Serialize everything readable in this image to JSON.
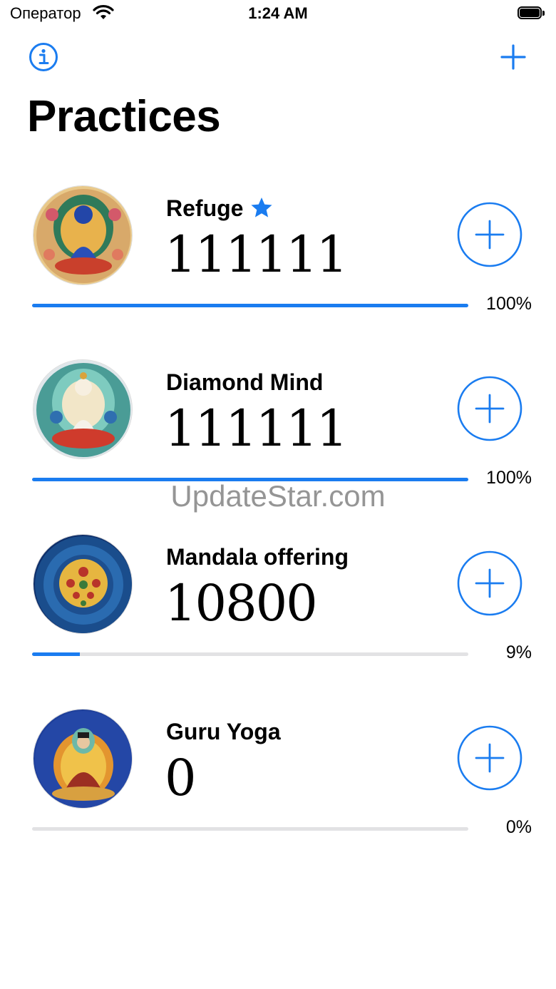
{
  "status": {
    "carrier": "Оператор",
    "time": "1:24 AM"
  },
  "nav": {
    "info_icon": "info-circle-icon",
    "add_icon": "plus-icon",
    "title": "Practices"
  },
  "practices": [
    {
      "name": "Refuge",
      "count": "111111",
      "percent_label": "100%",
      "progress": 1.0,
      "favorite": true,
      "image": "refuge-thangka"
    },
    {
      "name": "Diamond Mind",
      "count": "111111",
      "percent_label": "100%",
      "progress": 1.0,
      "favorite": false,
      "image": "diamond-mind-thangka"
    },
    {
      "name": "Mandala offering",
      "count": "10800",
      "percent_label": "9%",
      "progress": 0.11,
      "favorite": false,
      "image": "mandala-thangka"
    },
    {
      "name": "Guru Yoga",
      "count": "0",
      "percent_label": "0%",
      "progress": 0.0,
      "favorite": false,
      "image": "guru-yoga-thangka"
    }
  ],
  "watermark": "UpdateStar.com",
  "colors": {
    "accent": "#1a7cf0",
    "track": "#e2e2e4",
    "text": "#000000"
  }
}
